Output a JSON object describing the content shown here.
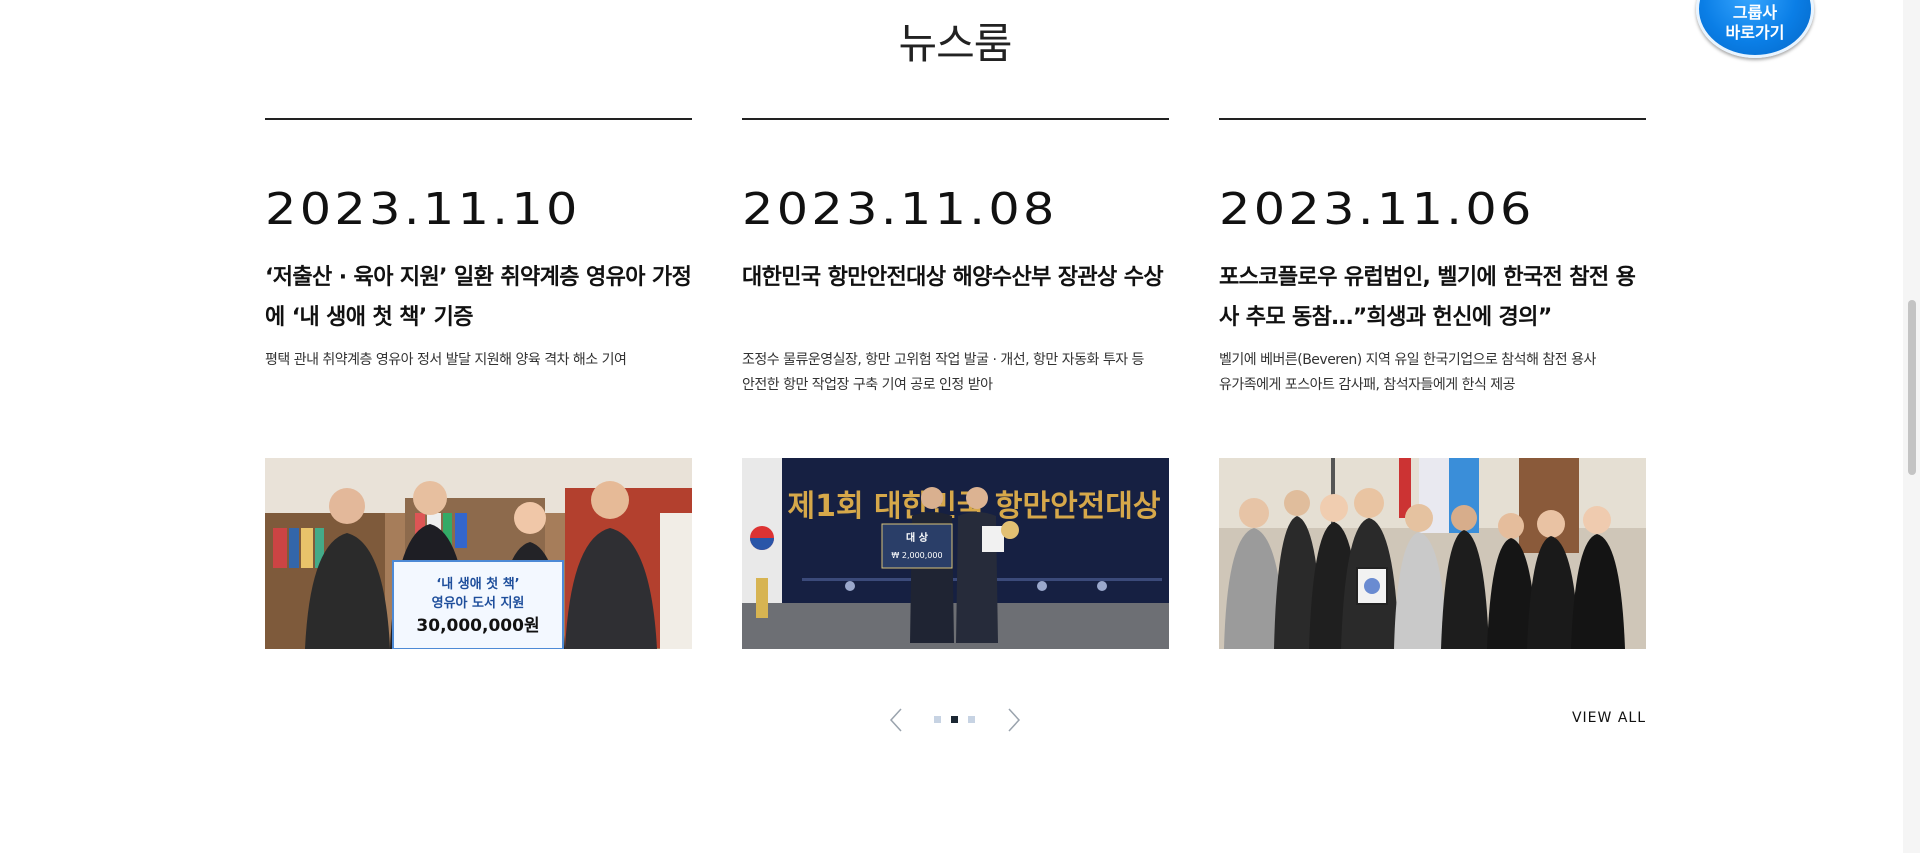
{
  "section": {
    "title": "뉴스룸"
  },
  "cards": [
    {
      "date": "2023.11.10",
      "title": "‘저출산 · 육아 지원’ 일환 취약계층 영유아 가정에 ‘내 생애 첫 책’ 기증",
      "summary": "평택 관내 취약계층 영유아 정서 발달 지원해 양육 격차 해소 기여",
      "image": {
        "banner_line1": "‘내 생애 첫 책’",
        "banner_line2": "영유아 도서 지원",
        "banner_amount": "30,000,000원"
      }
    },
    {
      "date": "2023.11.08",
      "title": "대한민국 항만안전대상 해양수산부 장관상 수상",
      "summary": "조정수 물류운영실장, 항만 고위험 작업 발굴 · 개선, 항만 자동화 투자 등\n안전한 항만 작업장 구축 기여 공로 인정 받아",
      "image": {
        "backdrop_text": "제1회 대한민국 항만안전대상",
        "board_title": "대 상",
        "board_amount": "₩ 2,000,000"
      }
    },
    {
      "date": "2023.11.06",
      "title": "포스코플로우 유럽법인, 벨기에 한국전 참전 용사 추모 동참…”희생과 헌신에 경의”",
      "summary": "벨기에 베버른(Beveren) 지역 유일 한국기업으로 참석해 참전 용사\n유가족에게 포스아트 감사패, 참석자들에게 한식 제공",
      "image": {}
    }
  ],
  "pager": {
    "total": 3,
    "active_index": 2
  },
  "view_all_label": "VIEW ALL",
  "group_button": {
    "label": "그룹사\n바로가기"
  },
  "colors": {
    "accent_blue": "#0a7ee6",
    "active_dot": "#1b2733",
    "inactive_dot": "#c7d3e3",
    "rule": "#222222"
  }
}
